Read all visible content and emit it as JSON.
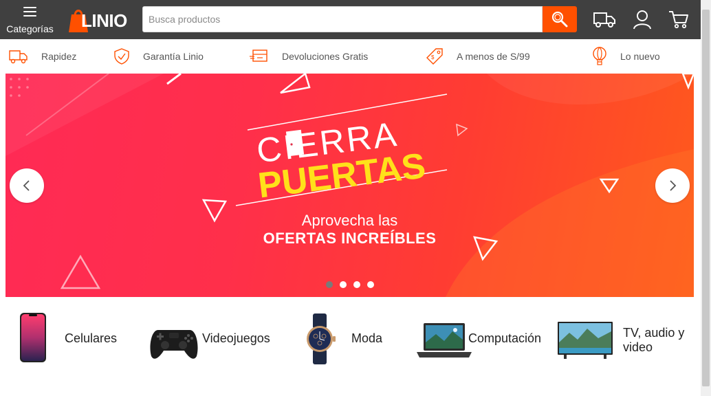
{
  "header": {
    "categories_label": "Categorías",
    "logo_text": "LINIO",
    "search_placeholder": "Busca productos",
    "icons": [
      "search-icon",
      "delivery-truck-icon",
      "user-icon",
      "cart-icon"
    ]
  },
  "benefits": [
    {
      "label": "Rapidez",
      "icon": "truck-icon"
    },
    {
      "label": "Garantía Linio",
      "icon": "shield-check-icon"
    },
    {
      "label": "Devoluciones Gratis",
      "icon": "return-box-icon"
    },
    {
      "label": "A menos de S/99",
      "icon": "price-tag-icon"
    },
    {
      "label": "Lo nuevo",
      "icon": "balloon-icon"
    }
  ],
  "banner": {
    "title_line1": "CIERRA",
    "title_line2": "PUERTAS",
    "subtitle_line1": "Aprovecha las",
    "subtitle_line2": "OFERTAS INCREÍBLES",
    "slides_total": 4,
    "active_slide": 1
  },
  "categories": [
    {
      "label": "Celulares"
    },
    {
      "label": "Videojuegos"
    },
    {
      "label": "Moda"
    },
    {
      "label": "Computación"
    },
    {
      "label": "TV, audio y video"
    }
  ],
  "colors": {
    "header_bg": "#404040",
    "accent": "#ff5000",
    "banner_yellow": "#ffe11a"
  }
}
